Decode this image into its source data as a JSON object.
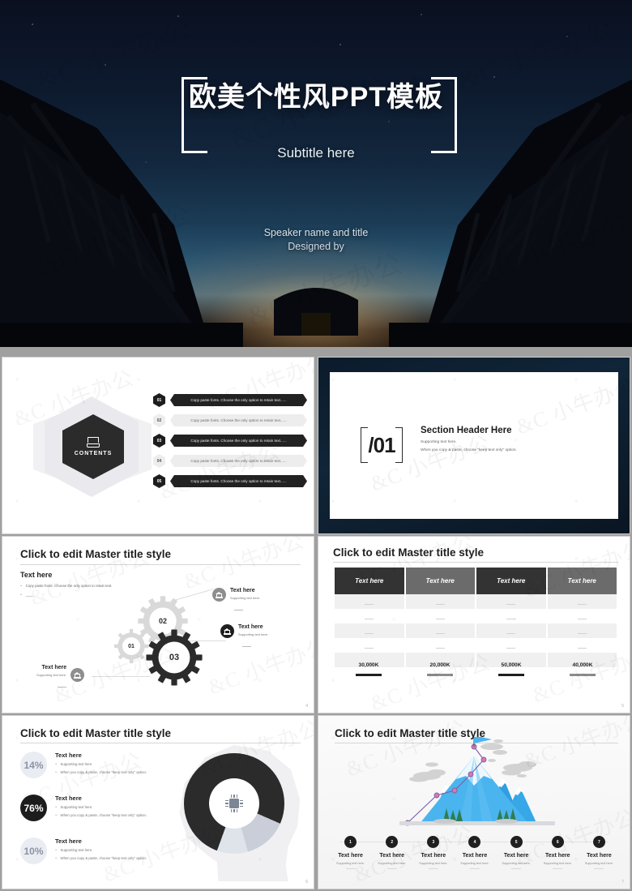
{
  "cover": {
    "title": "欧美个性风PPT模板",
    "subtitle": "Subtitle here",
    "speaker": "Speaker name and title",
    "designed_by": "Designed by"
  },
  "contents": {
    "hex_label": "CONTENTS",
    "hex_icon": "tray-icon",
    "items": [
      {
        "num": "01",
        "text": "Copy paste fonts. Choose the only option to retain text......",
        "style": "dark"
      },
      {
        "num": "02",
        "text": "Copy paste fonts. Choose the only option to retain text......",
        "style": "light"
      },
      {
        "num": "03",
        "text": "Copy paste fonts. Choose the only option to retain text......",
        "style": "dark"
      },
      {
        "num": "04",
        "text": "Copy paste fonts. Choose the only option to retain text......",
        "style": "light"
      },
      {
        "num": "05",
        "text": "Copy paste fonts. Choose the only option to retain text......",
        "style": "dark"
      }
    ]
  },
  "section": {
    "number": "/01",
    "heading": "Section Header Here",
    "support1": "Supporting text here.",
    "support2": "When you copy & paste, choose \"keep text only\" option."
  },
  "gears": {
    "title": "Click to edit Master title style",
    "page": "4",
    "left_heading": "Text here",
    "left_bullets": [
      "Copy paste fonts. Choose the only option to retain text.",
      "____"
    ],
    "gear_labels": [
      "01",
      "02",
      "03"
    ],
    "nodes": [
      {
        "title": "Text here",
        "support": "Supporting text here.",
        "icon": "bank-icon",
        "style": "mid"
      },
      {
        "title": "Text here",
        "support": "Supporting text here.",
        "icon": "bank-icon",
        "style": "dark"
      },
      {
        "title": "Text here",
        "support": "Supporting text here.",
        "icon": "bank-icon",
        "style": "mid"
      }
    ]
  },
  "table": {
    "title": "Click to edit Master title style",
    "page": "5",
    "headers": [
      {
        "label": "Text here",
        "style": "d"
      },
      {
        "label": "Text here",
        "style": "m"
      },
      {
        "label": "Text here",
        "style": "d"
      },
      {
        "label": "Text here",
        "style": "m"
      }
    ],
    "row_count": 5,
    "footer": [
      {
        "value": "30,000K",
        "style": "d"
      },
      {
        "value": "20,000K",
        "style": "m"
      },
      {
        "value": "50,000K",
        "style": "d"
      },
      {
        "value": "40,000K",
        "style": "m"
      }
    ]
  },
  "donut": {
    "title": "Click to edit Master title style",
    "page": "6",
    "icon": "cpu-chip-icon",
    "items": [
      {
        "percent": "14%",
        "style": "light",
        "title": "Text here",
        "b1": "Supporting text here.",
        "b2": "When you copy & paste, choose \"keep text only\" option."
      },
      {
        "percent": "76%",
        "style": "dark",
        "title": "Text here",
        "b1": "Supporting text here.",
        "b2": "When you copy & paste, choose \"keep text only\" option."
      },
      {
        "percent": "10%",
        "style": "light",
        "title": "Text here",
        "b1": "Supporting text here.",
        "b2": "When you copy & paste, choose \"keep text only\" option."
      }
    ]
  },
  "mountain": {
    "title": "Click to edit Master title style",
    "page": "7",
    "steps": [
      {
        "num": "1",
        "title": "Text here",
        "support": "Supporting text here."
      },
      {
        "num": "2",
        "title": "Text here",
        "support": "Supporting text here."
      },
      {
        "num": "3",
        "title": "Text here",
        "support": "Supporting text here."
      },
      {
        "num": "4",
        "title": "Text here",
        "support": "Supporting text here."
      },
      {
        "num": "5",
        "title": "Text here",
        "support": "Supporting text here."
      },
      {
        "num": "6",
        "title": "Text here",
        "support": "Supporting text here."
      },
      {
        "num": "7",
        "title": "Text here",
        "support": "Supporting text here."
      }
    ]
  },
  "chart_data": {
    "type": "pie",
    "title": "Click to edit Master title style",
    "labels": [
      "Text here",
      "Text here",
      "Text here"
    ],
    "values": [
      76,
      14,
      10
    ],
    "value_labels": [
      "76%",
      "14%",
      "10%"
    ],
    "colors": [
      "#2b2b2b",
      "#c9ced8",
      "#dfe3ea"
    ],
    "donut": true,
    "legend": "left"
  },
  "colors": {
    "accent_dark": "#1f1f1f",
    "accent_mid": "#6b6b6b",
    "accent_light": "#ededed",
    "page_bg": "#a0a0a0"
  }
}
